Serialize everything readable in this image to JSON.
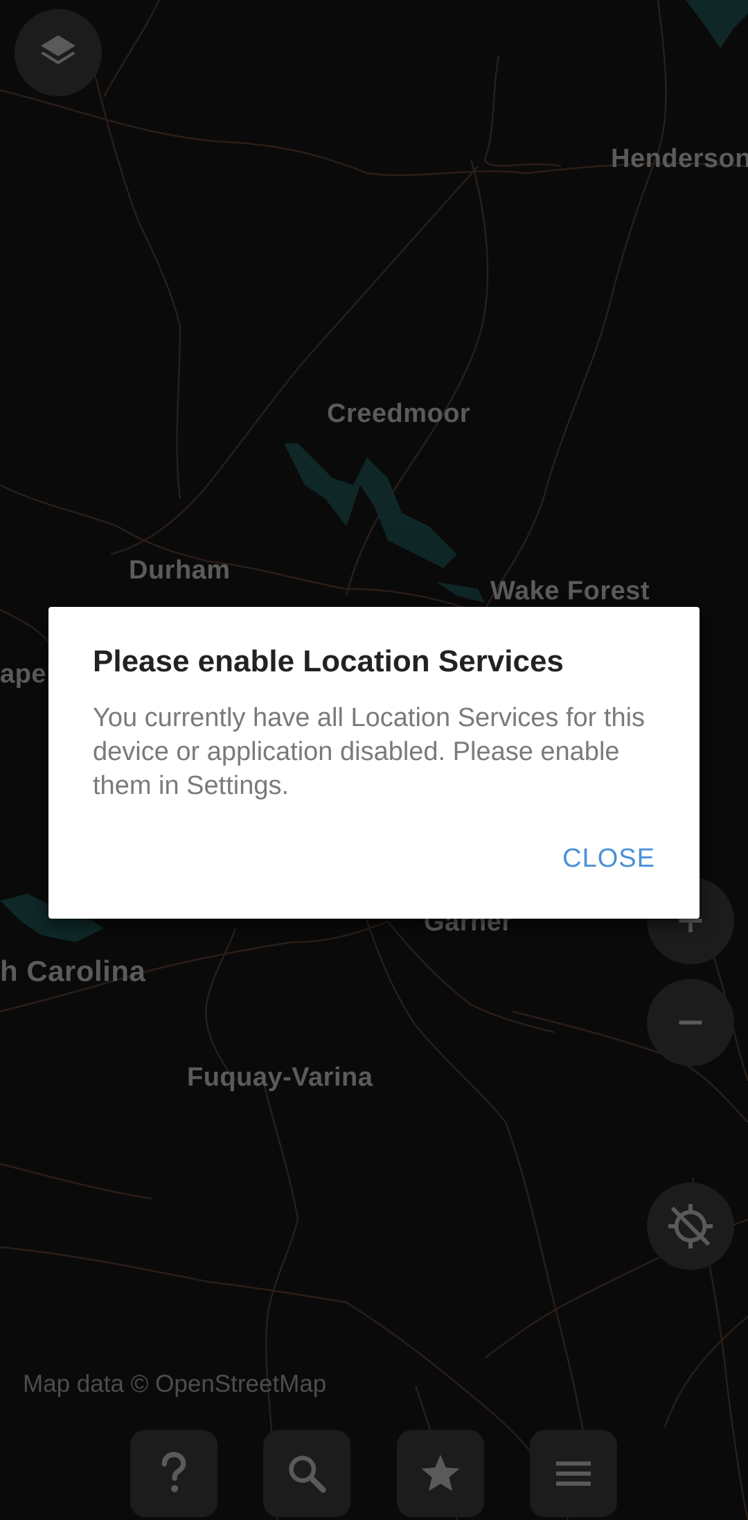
{
  "map": {
    "cities": [
      {
        "id": "henderson",
        "label": "Henderson"
      },
      {
        "id": "creedmoor",
        "label": "Creedmoor"
      },
      {
        "id": "durham",
        "label": "Durham"
      },
      {
        "id": "wake-forest",
        "label": "Wake Forest"
      },
      {
        "id": "chapel-hill",
        "label": "apel"
      },
      {
        "id": "garner",
        "label": "Garner"
      },
      {
        "id": "north-carolina",
        "label": "h Carolina"
      },
      {
        "id": "fuquay-varina",
        "label": "Fuquay-Varina"
      }
    ],
    "attribution": "Map data © OpenStreetMap"
  },
  "controls": {
    "layers_icon": "layers-icon",
    "zoom_in_icon": "plus-icon",
    "zoom_out_icon": "minus-icon",
    "location_icon": "location-disabled-icon"
  },
  "bottom_bar": {
    "help_icon": "question-icon",
    "search_icon": "search-icon",
    "favorites_icon": "star-icon",
    "menu_icon": "menu-icon"
  },
  "dialog": {
    "title": "Please enable Location Services",
    "message": "You currently have all Location Services for this device or application disabled. Please enable them in Settings.",
    "close_label": "CLOSE"
  },
  "colors": {
    "dialog_button": "#4a90d9",
    "map_background": "#0a0a0a"
  }
}
